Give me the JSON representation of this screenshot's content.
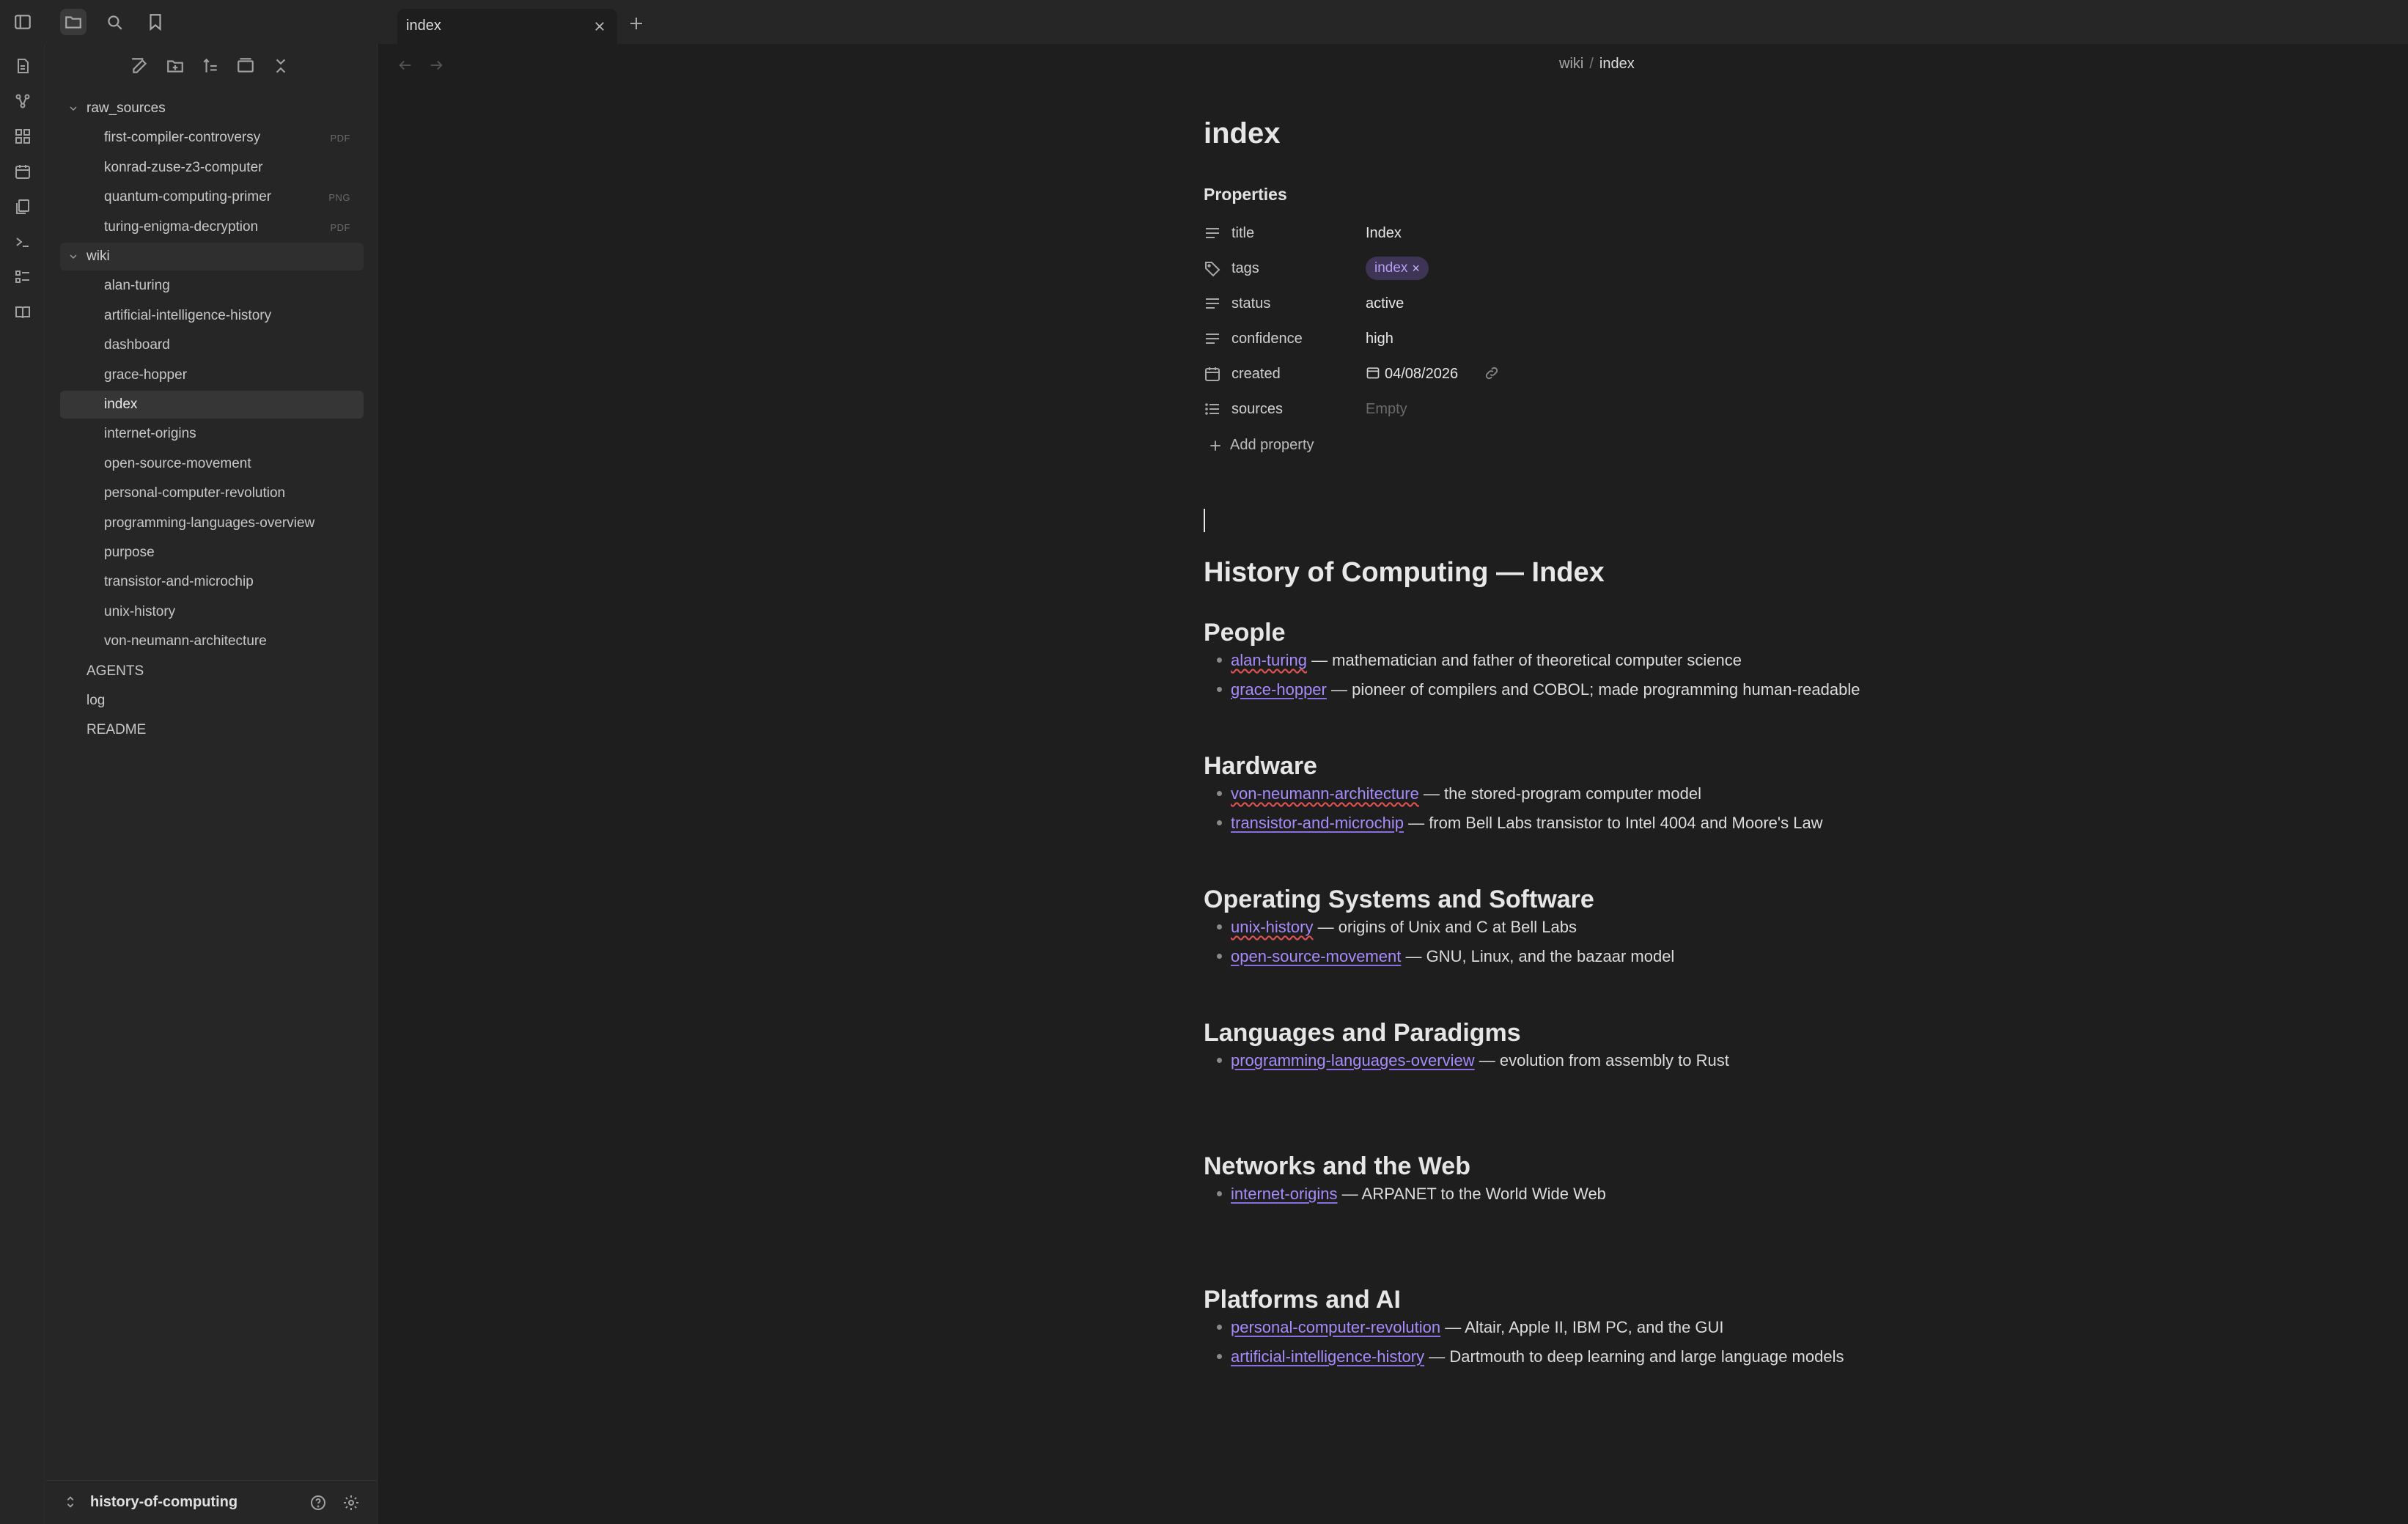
{
  "tabs": [
    {
      "label": "index"
    }
  ],
  "breadcrumb": {
    "parent": "wiki",
    "sep": "/",
    "current": "index"
  },
  "sidebar": {
    "tree": [
      {
        "label": "raw_sources",
        "type": "folder"
      },
      {
        "label": "first-compiler-controversy",
        "badge": "PDF"
      },
      {
        "label": "konrad-zuse-z3-computer",
        "badge": ""
      },
      {
        "label": "quantum-computing-primer",
        "badge": "PNG"
      },
      {
        "label": "turing-enigma-decryption",
        "badge": "PDF"
      },
      {
        "label": "wiki",
        "type": "folder"
      },
      {
        "label": "alan-turing"
      },
      {
        "label": "artificial-intelligence-history"
      },
      {
        "label": "dashboard"
      },
      {
        "label": "grace-hopper"
      },
      {
        "label": "index",
        "active": true
      },
      {
        "label": "internet-origins"
      },
      {
        "label": "open-source-movement"
      },
      {
        "label": "personal-computer-revolution"
      },
      {
        "label": "programming-languages-overview"
      },
      {
        "label": "purpose"
      },
      {
        "label": "transistor-and-microchip"
      },
      {
        "label": "unix-history"
      },
      {
        "label": "von-neumann-architecture"
      },
      {
        "label": "AGENTS"
      },
      {
        "label": "log"
      },
      {
        "label": "README"
      }
    ],
    "vault_name": "history-of-computing"
  },
  "doc": {
    "title": "index",
    "properties_heading": "Properties",
    "properties": {
      "title": {
        "key": "title",
        "value": "Index"
      },
      "tags": {
        "key": "tags",
        "value": "index",
        "remove": "×"
      },
      "status": {
        "key": "status",
        "value": "active"
      },
      "confidence": {
        "key": "confidence",
        "value": "high"
      },
      "created": {
        "key": "created",
        "value": "04/08/2026"
      },
      "sources": {
        "key": "sources",
        "value": "Empty"
      }
    },
    "add_property": "Add property",
    "h1": "History of Computing — Index",
    "sections": [
      {
        "heading": "People",
        "items": [
          {
            "link": "alan-turing",
            "text": " — mathematician and father of theoretical computer science",
            "unresolved": true
          },
          {
            "link": "grace-hopper",
            "text": " — pioneer of compilers and COBOL; made programming human-readable"
          }
        ]
      },
      {
        "heading": "Hardware",
        "items": [
          {
            "link": "von-neumann-architecture",
            "text": " — the stored-program computer model",
            "unresolved": true
          },
          {
            "link": "transistor-and-microchip",
            "text": " — from Bell Labs transistor to Intel 4004 and Moore's Law"
          }
        ]
      },
      {
        "heading": "Operating Systems and Software",
        "items": [
          {
            "link": "unix-history",
            "text": " — origins of Unix and C at Bell Labs",
            "unresolved": true
          },
          {
            "link": "open-source-movement",
            "text": " — GNU, Linux, and the bazaar model"
          }
        ]
      },
      {
        "heading": "Languages and Paradigms",
        "items": [
          {
            "link": "programming-languages-overview",
            "text": " — evolution from assembly to Rust"
          }
        ]
      },
      {
        "heading": "Networks and the Web",
        "items": [
          {
            "link": "internet-origins",
            "text": " — ARPANET to the World Wide Web"
          }
        ]
      },
      {
        "heading": "Platforms and AI",
        "items": [
          {
            "link": "personal-computer-revolution",
            "text": " — Altair, Apple II, IBM PC, and the GUI"
          },
          {
            "link": "artificial-intelligence-history",
            "text": " — Dartmouth to deep learning and large language models"
          }
        ]
      }
    ]
  },
  "colors": {
    "accent": "#a78bfa",
    "tag_bg": "#3d3456",
    "background": "#1e1e1e",
    "sidebar": "#262626"
  }
}
